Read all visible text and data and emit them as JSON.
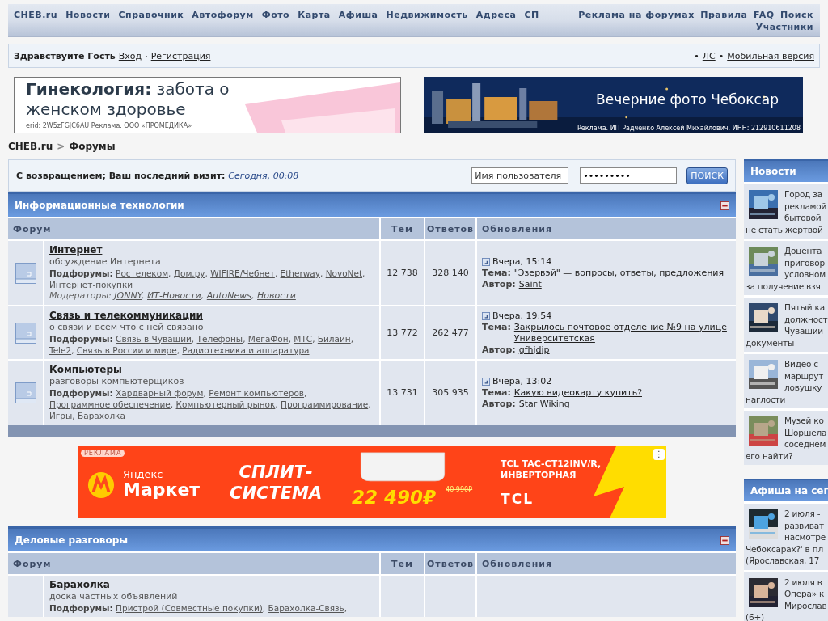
{
  "nav": {
    "left": [
      "CHEB.ru",
      "Новости",
      "Справочник",
      "Автофорум",
      "Фото",
      "Карта",
      "Афиша",
      "Недвижимость",
      "Адреса",
      "СП"
    ],
    "right": [
      "Реклама на форумах",
      "Правила",
      "FAQ",
      "Поиск",
      "Участники"
    ]
  },
  "user_bar": {
    "greeting": "Здравствуйте Гость",
    "links": [
      "Вход",
      "Регистрация"
    ],
    "separator": "·",
    "bullet": "•",
    "right_links": [
      "ЛС",
      "Мобильная версия"
    ]
  },
  "ads": [
    {
      "kind": "light",
      "headline": "**Гинекология:** забота о женском здоровье",
      "note": "erid: 2W5zFGJC6AU Реклама. ООО «ПРОМЕДИКА»"
    },
    {
      "headline": "Вечерние фото Чебоксар",
      "note": "Реклама. ИП Радченко Алексей Михайлович. ИНН: 212910611208"
    }
  ],
  "breadcrumb": {
    "items": [
      "CHEB.ru",
      "Форумы"
    ],
    "separator": ">"
  },
  "welcome": {
    "text": "С возвращением; Ваш последний визит:",
    "visit": "Сегодня, 00:08",
    "username_placeholder": "Имя пользователя",
    "password_value": "•••••••••",
    "button": "ПОИСК"
  },
  "list_separator": ",",
  "categories": [
    {
      "title": "Информационные технологии",
      "footer": true,
      "columns": [
        "Форум",
        "Тем",
        "Ответов",
        "Обновления"
      ],
      "forums": [
        {
          "icon": true,
          "title": "Интернет",
          "description": "обсуждение Интернета",
          "subforums_label": "Подфорумы:",
          "subforums": [
            "Ростелеком",
            "Дом.ру",
            "WIFIRE/Чебнет",
            "Etherway",
            "NovoNet",
            "Интернет-покупки"
          ],
          "moderators_label": "Модераторы:",
          "moderators": [
            "JONNY",
            "ИТ-Новости",
            "AutoNews",
            "Новости"
          ],
          "topics": "12 738",
          "replies": "328 140",
          "last": {
            "time": "Вчера, 15:14",
            "topic_label": "Тема:",
            "topic": "\"Эзервэй\" — вопросы, ответы, предложения",
            "author_label": "Автор:",
            "author": "Saint"
          }
        },
        {
          "icon": true,
          "title": "Связь и телекоммуникации",
          "description": "о связи и всем что с ней связано",
          "subforums_label": "Подфорумы:",
          "subforums": [
            "Связь в Чувашии",
            "Телефоны",
            "МегаФон",
            "МТС",
            "Билайн",
            "Tele2",
            "Связь в России и мире",
            "Радиотехника и аппаратура"
          ],
          "topics": "13 772",
          "replies": "262 477",
          "last": {
            "time": "Вчера, 19:54",
            "topic_label": "Тема:",
            "topic": "Закрылось почтовое отделение №9 на улице Университетская",
            "author_label": "Автор:",
            "author": "gfhjdjp"
          }
        },
        {
          "icon": true,
          "title": "Компьютеры",
          "description": "разговоры компьютерщиков",
          "subforums_label": "Подфорумы:",
          "subforums": [
            "Хардварный форум",
            "Ремонт компьютеров",
            "Программное обеспечение",
            "Компьютерный рынок",
            "Программирование",
            "Игры",
            "Барахолка"
          ],
          "topics": "13 731",
          "replies": "305 935",
          "last": {
            "time": "Вчера, 13:02",
            "topic_label": "Тема:",
            "topic": "Какую видеокарту купить?",
            "author_label": "Автор:",
            "author": "Star Wiking"
          }
        }
      ]
    },
    {
      "title": "Деловые разговоры",
      "footer": false,
      "columns": [
        "Форум",
        "Тем",
        "Ответов",
        "Обновления"
      ],
      "forums": [
        {
          "icon": false,
          "title": "Барахолка",
          "description": "доска частных объявлений",
          "subforums_label": "Подфорумы:",
          "subforums": [
            "Пристрой (Совместные покупки)",
            "Барахолка-Связь"
          ],
          "trailing_separator": true
        }
      ]
    }
  ],
  "banner": {
    "badge": "РЕКЛАМА",
    "brand_top": "Яндекс",
    "brand": "Маркет",
    "headline": "СПЛИТ-СИСТЕМА",
    "price": "22 490₽",
    "old_price": "40 990₽",
    "product": "TCL TAC-CT12INV/R, ИНВЕРТОРНАЯ",
    "maker": "TCL",
    "menu": "⋮"
  },
  "sidebar": [
    {
      "title": "Новости",
      "items": [
        {
          "lines": [
            "Город за",
            "рекламой",
            "бытовой",
            "не стать жертвой"
          ]
        },
        {
          "lines": [
            "Доцента",
            "приговор",
            "условном",
            "за получение взя"
          ]
        },
        {
          "lines": [
            "Пятый ка",
            "должност",
            "Чувашии",
            "документы"
          ]
        },
        {
          "lines": [
            "Видео с",
            "маршрут",
            "ловушку",
            "наглости"
          ]
        },
        {
          "lines": [
            "Музей ко",
            "Шоршела",
            "соседнем",
            "его найти?"
          ]
        }
      ]
    },
    {
      "title": "Афиша на сег",
      "items": [
        {
          "lines": [
            "2 июля -",
            "развиват",
            "насмотре",
            "Чебоксарах?' в пл",
            "(Ярославская, 17"
          ]
        },
        {
          "lines": [
            "2 июля в",
            "Опера» к",
            "Мирослав",
            "(6+)"
          ]
        }
      ]
    }
  ]
}
